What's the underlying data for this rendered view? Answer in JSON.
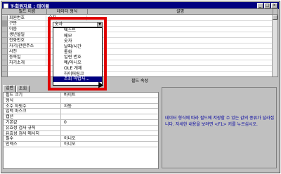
{
  "window": {
    "title": "T-회원자료 : 테이블"
  },
  "grid": {
    "headers": [
      "필드 이름",
      "데이터 형식",
      "설명"
    ],
    "rows": [
      {
        "name": "회원번호",
        "type": "숫자"
      },
      {
        "name": "구분",
        "type": "숫자"
      },
      {
        "name": "이름",
        "type": ""
      },
      {
        "name": "생년월일",
        "type": ""
      },
      {
        "name": "전화번호",
        "type": ""
      },
      {
        "name": "자기/관련주소",
        "type": ""
      },
      {
        "name": "사진",
        "type": ""
      },
      {
        "name": "등록일",
        "type": ""
      },
      {
        "name": "자기소개",
        "type": ""
      }
    ]
  },
  "dropdown": {
    "options": [
      "텍스트",
      "메모",
      "숫자",
      "날짜/시간",
      "통화",
      "일련 번호",
      "예/아니오",
      "OLE 개체",
      "하이퍼링크",
      "조회 마법사..."
    ],
    "highlighted_index": 9
  },
  "properties": {
    "section_label": "필드 속성",
    "tabs": [
      "일반",
      "조회"
    ],
    "rows": [
      {
        "label": "필드 크기",
        "value": "바이트"
      },
      {
        "label": "형식",
        "value": ""
      },
      {
        "label": "소수 자릿수",
        "value": "자동"
      },
      {
        "label": "입력 마스크",
        "value": ""
      },
      {
        "label": "캡션",
        "value": ""
      },
      {
        "label": "기본값",
        "value": "0"
      },
      {
        "label": "유효성 검사 규칙",
        "value": ""
      },
      {
        "label": "유효성 검사 메시지",
        "value": ""
      },
      {
        "label": "필수",
        "value": "아니오"
      },
      {
        "label": "인덱스",
        "value": "아니오"
      }
    ]
  },
  "help": {
    "text": "데이터 형식에 따라 필드에 저장할 수 있는 값의 종류가 달라집니다. 자세한 내용을 보려면 <F1> 키를 누르십시오."
  },
  "colors": {
    "title_bar": "#000080",
    "highlight": "#000080",
    "annotation_box": "#e00000"
  }
}
